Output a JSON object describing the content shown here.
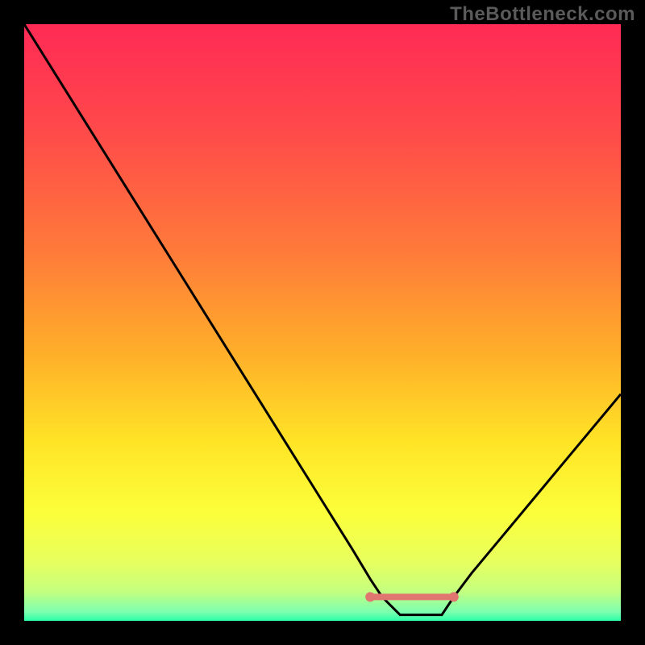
{
  "attribution": "TheBottleneck.com",
  "colors": {
    "gradient_stops": [
      {
        "offset": 0.0,
        "color": "#ff2a55"
      },
      {
        "offset": 0.18,
        "color": "#ff4a4a"
      },
      {
        "offset": 0.38,
        "color": "#ff7a3a"
      },
      {
        "offset": 0.55,
        "color": "#ffae2a"
      },
      {
        "offset": 0.7,
        "color": "#ffe426"
      },
      {
        "offset": 0.82,
        "color": "#fbff3a"
      },
      {
        "offset": 0.9,
        "color": "#e8ff5e"
      },
      {
        "offset": 0.95,
        "color": "#c5ff7e"
      },
      {
        "offset": 0.985,
        "color": "#7dffb0"
      },
      {
        "offset": 1.0,
        "color": "#2bffa8"
      }
    ],
    "curve": "#000000",
    "flat_segment": "#e0766f",
    "dot": "#e0766f",
    "frame_bg": "#000000"
  },
  "chart_data": {
    "type": "line",
    "title": "",
    "xlabel": "",
    "ylabel": "",
    "x_range": [
      0,
      100
    ],
    "y_range": [
      0,
      100
    ],
    "series": [
      {
        "name": "bottleneck-curve",
        "x": [
          0,
          5,
          10,
          15,
          20,
          25,
          30,
          35,
          40,
          45,
          50,
          55,
          58,
          60,
          63,
          67,
          70,
          72,
          75,
          80,
          85,
          90,
          95,
          100
        ],
        "y": [
          100,
          92,
          84,
          76,
          68,
          60,
          52,
          44,
          36,
          28,
          20,
          12,
          7,
          4,
          1,
          1,
          1,
          4,
          8,
          14,
          20,
          26,
          32,
          38
        ]
      }
    ],
    "flat_region": {
      "x_start": 58,
      "x_end": 72,
      "y": 4
    },
    "notes": "Axes have no visible tick labels; x and y are normalized 0-100. y=0 is the bottom (optimal / green), y=100 is the top (worst / red). The curve descends from top-left, reaches a minimum plateau around x≈58–72, then rises toward the right edge."
  }
}
